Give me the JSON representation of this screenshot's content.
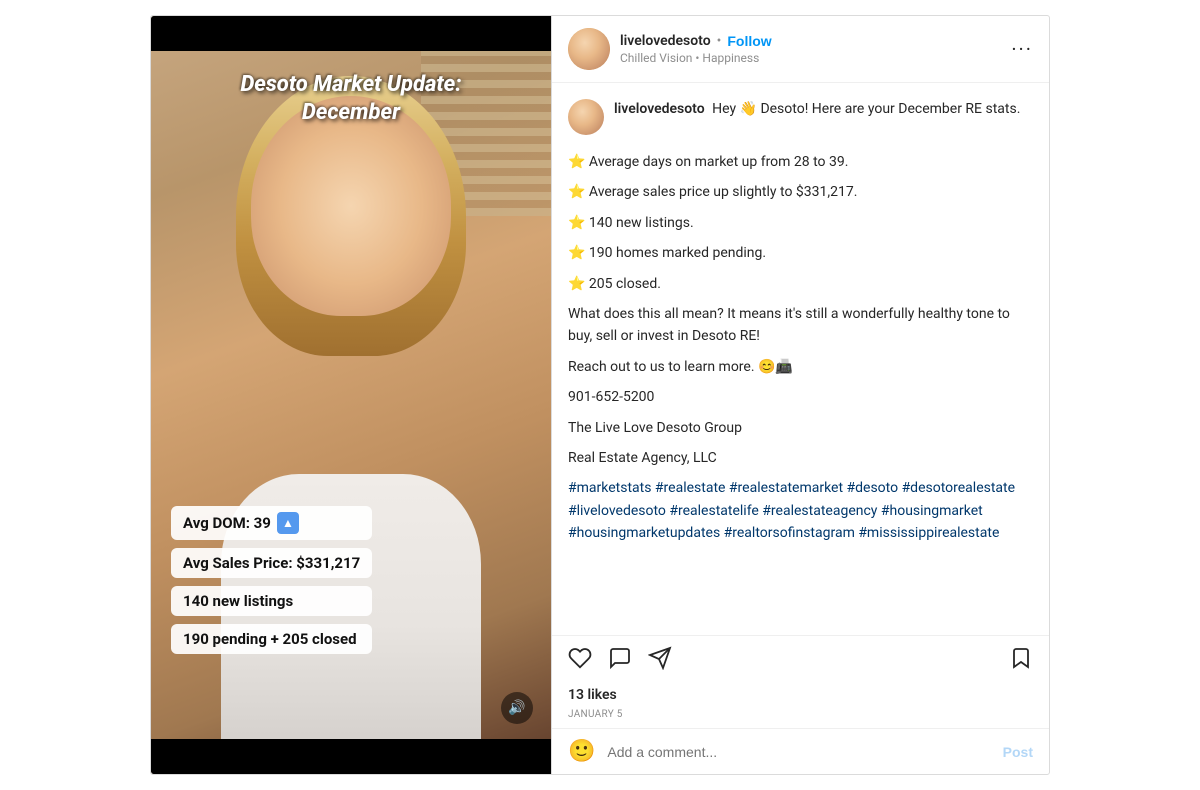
{
  "header": {
    "username": "livelovedesoto",
    "follow_label": "Follow",
    "separator": "•",
    "location": "Chilled Vision • Happiness",
    "more_icon": "···"
  },
  "caption": {
    "username": "livelovedesoto",
    "greeting": "Hey 👋 Desoto! Here are your December RE stats.",
    "stats_intro": "",
    "stat1": "⭐ Average days on market up from 28 to 39.",
    "stat2": "⭐ Average sales price up slightly to $331,217.",
    "stat3": "⭐ 140 new listings.",
    "stat4": "⭐ 190 homes marked pending.",
    "stat5": "⭐ 205 closed.",
    "meaning": "What does this all mean? It means it's still a wonderfully healthy tone to buy, sell or invest in Desoto RE!",
    "reach_out": "Reach out to us to learn more. 😊📠",
    "phone": "901-652-5200",
    "company1": "The Live Love Desoto Group",
    "company2": "Real Estate Agency, LLC",
    "hashtags": "#marketstats #realestate #realestatemarket #desoto #desotorealestate #livelovedesoto #realestatelife #realestateagency #housingmarket #housingmarketupdates #realtorsofinstagram #mississippirealestate"
  },
  "video_overlay": {
    "title": "Desoto Market Update: December",
    "stat1": "Avg DOM: 39",
    "stat2": "Avg Sales Price: $331,217",
    "stat3": "140 new listings",
    "stat4": "190 pending + 205 closed",
    "sound_icon": "🔊"
  },
  "actions": {
    "like_icon": "heart",
    "comment_icon": "comment",
    "share_icon": "paper-plane",
    "bookmark_icon": "bookmark"
  },
  "likes": {
    "count": "13 likes"
  },
  "date": {
    "text": "JANUARY 5"
  },
  "comment_input": {
    "placeholder": "Add a comment...",
    "post_label": "Post"
  }
}
